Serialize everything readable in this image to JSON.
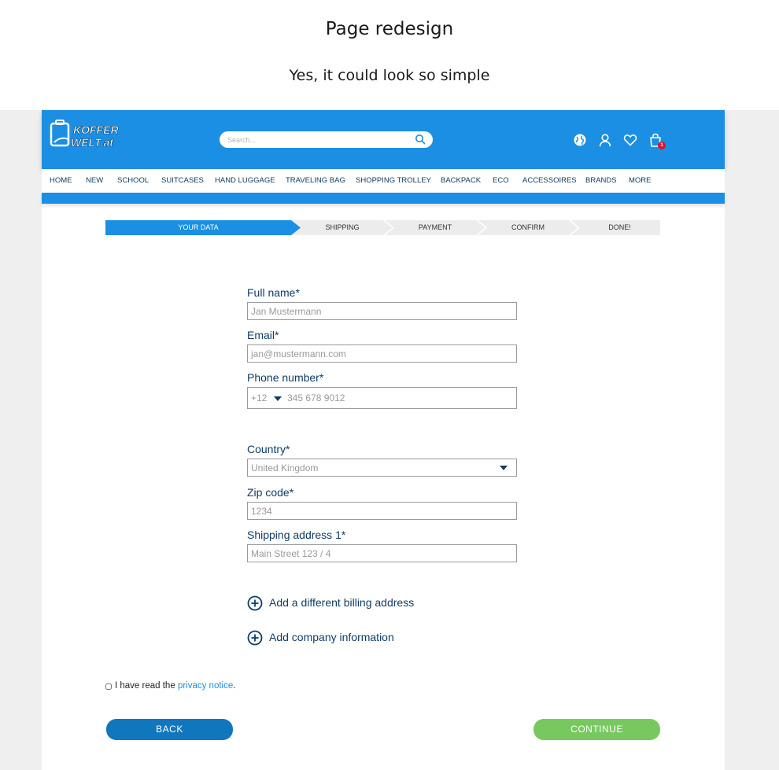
{
  "banner": {
    "title": "Page redesign",
    "subtitle": "Yes, it could look so simple"
  },
  "header": {
    "logo_text_top": "KOFFER",
    "logo_text_bottom": "WELT.at",
    "search_placeholder": "Search...",
    "cart_count": "1"
  },
  "nav": {
    "items": [
      "HOME",
      "NEW",
      "SCHOOL",
      "SUITCASES",
      "HAND LUGGAGE",
      "TRAVELING BAG",
      "SHOPPING TROLLEY",
      "BACKPACK",
      "ECO",
      "ACCESSOIRES",
      "BRANDS",
      "MORE"
    ]
  },
  "steps": [
    "YOUR DATA",
    "SHIPPING",
    "PAYMENT",
    "CONFIRM",
    "DONE!"
  ],
  "form": {
    "full_name": {
      "label": "Full name*",
      "placeholder": "Jan Mustermann"
    },
    "email": {
      "label": "Email*",
      "placeholder": "jan@mustermann.com"
    },
    "phone": {
      "label": "Phone number*",
      "code": "+12",
      "placeholder": "345 678 9012"
    },
    "country": {
      "label": "Country*",
      "value": "United Kingdom"
    },
    "zip": {
      "label": "Zip code*",
      "placeholder": "1234"
    },
    "address1": {
      "label": "Shipping address 1*",
      "placeholder": "Main Street 123 / 4"
    },
    "add_billing": "Add a different billing address",
    "add_company": "Add company information"
  },
  "consent": {
    "text": "I have read the",
    "link": "privacy notice",
    "end": "."
  },
  "buttons": {
    "back": "BACK",
    "continue": "CONTINUE"
  },
  "colors": {
    "header_blue": "#1a8fe3",
    "navy": "#0f3c66",
    "back_button": "#1076bd",
    "continue_button": "#78c860",
    "badge_red": "#d6162b"
  }
}
